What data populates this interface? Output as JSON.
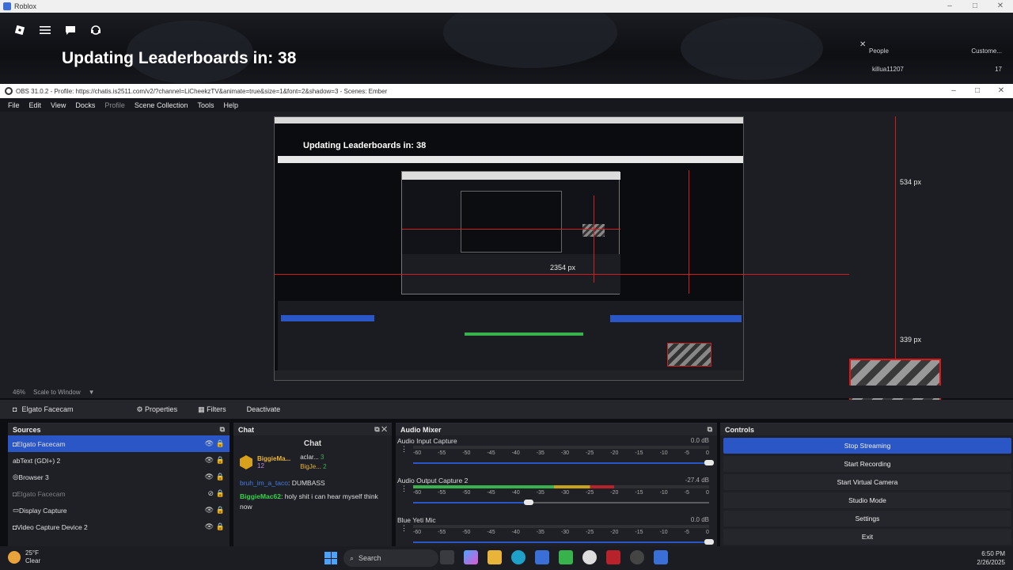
{
  "roblox_window": {
    "title": "Roblox"
  },
  "roblox": {
    "announcement": "Updating Leaderboards in: 38",
    "people_panel": {
      "header_left": "People",
      "header_right": "Custome...",
      "player_name": "killua11207",
      "player_value": "17"
    }
  },
  "obs": {
    "title": "OBS 31.0.2 - Profile: https://chatis.is2511.com/v2/?channel=LiCheekzTV&animate=true&size=1&font=2&shadow=3 - Scenes: Ember",
    "menu": [
      "File",
      "Edit",
      "View",
      "Docks",
      "Profile",
      "Scene Collection",
      "Tools",
      "Help"
    ],
    "preview": {
      "inner_title": "Updating Leaderboards in: 38",
      "label_top": "534 px",
      "label_bottom": "339 px",
      "label_width": "2354 px",
      "zoom": "46%",
      "scale_mode": "Scale to Window"
    },
    "source_toolbar": {
      "selected_source": "Elgato Facecam",
      "properties": "Properties",
      "filters": "Filters",
      "deactivate": "Deactivate"
    },
    "sources": {
      "title": "Sources",
      "items": [
        {
          "label": "Elgato Facecam",
          "selected": true
        },
        {
          "label": "Text (GDI+) 2",
          "selected": false
        },
        {
          "label": "Browser 3",
          "selected": false
        },
        {
          "label": "Elgato Facecam",
          "selected": false
        },
        {
          "label": "Display Capture",
          "selected": false
        },
        {
          "label": "Video Capture Device 2",
          "selected": false
        }
      ]
    },
    "chat": {
      "dock_title": "Chat",
      "panel_title": "Chat",
      "top_user": "BiggieMa...",
      "top_user_count": "12",
      "side_user_1": "aclar...",
      "side_user_1_count": "3",
      "side_user_2": "BigJe...",
      "side_user_2_count": "2",
      "messages": [
        {
          "user": "bruh_im_a_taco",
          "text": ": DUMBASS"
        },
        {
          "user": "BiggieMac62",
          "text": ": holy shit i can hear myself think now"
        }
      ]
    },
    "mixer": {
      "title": "Audio Mixer",
      "channels": [
        {
          "name": "Audio Input Capture",
          "db": "0.0 dB",
          "level": 0.0,
          "volume": 1.0
        },
        {
          "name": "Audio Output Capture 2",
          "db": "-27.4 dB",
          "level": 0.68,
          "volume": 0.39
        },
        {
          "name": "Blue Yeti Mic",
          "db": "0.0 dB",
          "level": 0.0,
          "volume": 1.0
        }
      ],
      "ticks": [
        "-60",
        "-55",
        "-50",
        "-45",
        "-40",
        "-35",
        "-30",
        "-25",
        "-20",
        "-15",
        "-10",
        "-5",
        "0"
      ]
    },
    "controls": {
      "title": "Controls",
      "buttons": [
        "Stop Streaming",
        "Start Recording",
        "Start Virtual Camera",
        "Studio Mode",
        "Settings",
        "Exit"
      ]
    }
  },
  "taskbar": {
    "temperature": "25°F",
    "weather": "Clear",
    "search_placeholder": "Search",
    "time": "6:50 PM",
    "date": "2/26/2025"
  },
  "colors": {
    "accent": "#2b57c6",
    "guide_red": "#d21c1c",
    "meter_green": "#37b24d",
    "meter_yellow": "#c8a21a",
    "meter_red": "#b8232b"
  }
}
